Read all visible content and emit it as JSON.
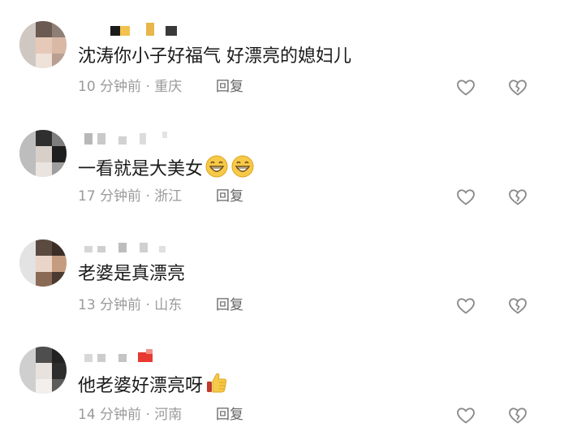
{
  "comments": [
    {
      "text": "沈涛你小子好福气 好漂亮的媳妇儿",
      "time": "10 分钟前",
      "location": "重庆",
      "reply_label": "回复"
    },
    {
      "text": "一看就是大美女",
      "emoji": "grinning-face-emoji ×2",
      "time": "17 分钟前",
      "location": "浙江",
      "reply_label": "回复"
    },
    {
      "text": "老婆是真漂亮",
      "time": "13 分钟前",
      "location": "山东",
      "reply_label": "回复"
    },
    {
      "text": "他老婆好漂亮呀",
      "emoji": "thumbs-up-emoji",
      "time": "14 分钟前",
      "location": "河南",
      "reply_label": "回复"
    }
  ],
  "separator": " · ",
  "icons": {
    "like": "heart-outline-icon",
    "dislike": "broken-heart-outline-icon"
  },
  "colors": {
    "text": "#1a1a1a",
    "meta": "#9a9a9a",
    "reply": "#666666",
    "icon": "#8a8a8a"
  }
}
